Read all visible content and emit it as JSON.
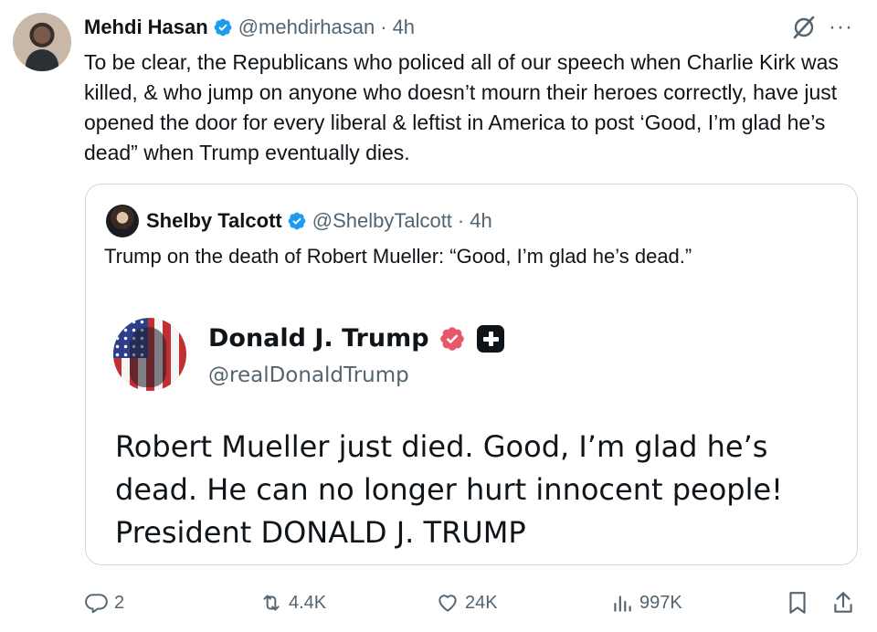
{
  "post": {
    "author_name": "Mehdi Hasan",
    "author_handle": "@mehdirhasan",
    "separator": "·",
    "time": "4h",
    "more": "···",
    "text": "To be clear, the Republicans who policed all of our speech when Charlie Kirk was killed, & who jump on anyone who doesn’t mourn their heroes correctly, have just opened the door for every liberal & leftist in America to post ‘Good, I’m glad he’s dead” when Trump eventually dies."
  },
  "quote": {
    "author_name": "Shelby Talcott",
    "author_handle": "@ShelbyTalcott",
    "separator": "·",
    "time": "4h",
    "text": "Trump on the death of Robert Mueller: “Good, I’m glad he’s dead.”",
    "embedded": {
      "author_name": "Donald J. Trump",
      "author_handle": "@realDonaldTrump",
      "text": "Robert Mueller just died. Good, I’m glad he’s dead. He can no longer hurt innocent people! President DONALD J. TRUMP"
    }
  },
  "actions": {
    "replies": "2",
    "reposts": "4.4K",
    "likes": "24K",
    "views": "997K"
  },
  "colors": {
    "verified_blue": "#1d9bf0",
    "truth_badge": "#e7586b",
    "secondary_text": "#536471",
    "border": "#cfd9de"
  },
  "icons": [
    "verified-badge-icon",
    "grok-icon",
    "more-icon",
    "reply-icon",
    "repost-icon",
    "like-icon",
    "views-icon",
    "bookmark-icon",
    "share-icon",
    "plus-icon"
  ]
}
